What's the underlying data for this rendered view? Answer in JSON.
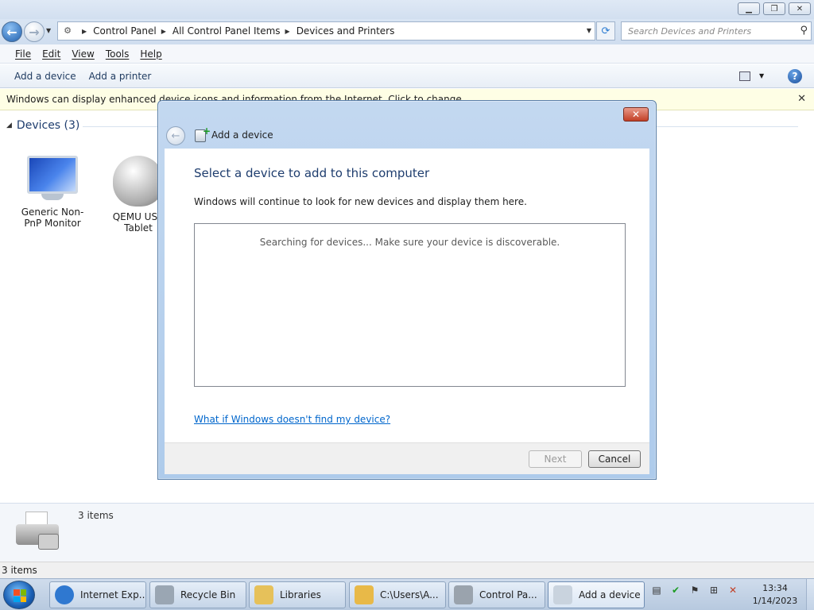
{
  "explorer": {
    "address": {
      "crumbs": [
        "Control Panel",
        "All Control Panel Items",
        "Devices and Printers"
      ],
      "search_placeholder": "Search Devices and Printers"
    },
    "menu": [
      "File",
      "Edit",
      "View",
      "Tools",
      "Help"
    ],
    "commands": [
      "Add a device",
      "Add a printer"
    ],
    "infobar_text": "Windows can display enhanced device icons and information from the Internet. Click to change...",
    "group_title": "Devices (3)",
    "devices": [
      {
        "label": "Generic Non-PnP Monitor",
        "icon": "monitor-icon"
      },
      {
        "label": "QEMU USB Tablet",
        "icon": "mouse-icon"
      }
    ],
    "detail_count": "3 items",
    "status_text": "3 items"
  },
  "dialog": {
    "title": "Add a device",
    "heading": "Select a device to add to this computer",
    "description": "Windows will continue to look for new devices and display them here.",
    "searching_message": "Searching for devices...  Make sure your device is discoverable.",
    "help_link": "What if Windows doesn't find my device?",
    "next_label": "Next",
    "cancel_label": "Cancel",
    "close_glyph": "✕"
  },
  "taskbar": {
    "tasks": [
      {
        "label": "Internet Exp...",
        "icon": "internet-explorer-icon",
        "color": "#2f78d0"
      },
      {
        "label": "Recycle Bin",
        "icon": "recycle-bin-icon",
        "color": "#9aa6b3"
      },
      {
        "label": "Libraries",
        "icon": "libraries-icon",
        "color": "#e6c15a"
      },
      {
        "label": "C:\\Users\\A...",
        "icon": "folder-icon",
        "color": "#e8b948"
      },
      {
        "label": "Control Pa...",
        "icon": "control-panel-icon",
        "color": "#9aa3ad"
      },
      {
        "label": "Add a device",
        "icon": "add-device-icon",
        "color": "#c9d3de"
      }
    ],
    "clock_time": "13:34",
    "clock_date": "1/14/2023"
  },
  "colors": {
    "accent": "#1e3d6e",
    "link": "#0066cc",
    "infobar_bg": "#fefee5",
    "close_red": "#c23f26"
  }
}
